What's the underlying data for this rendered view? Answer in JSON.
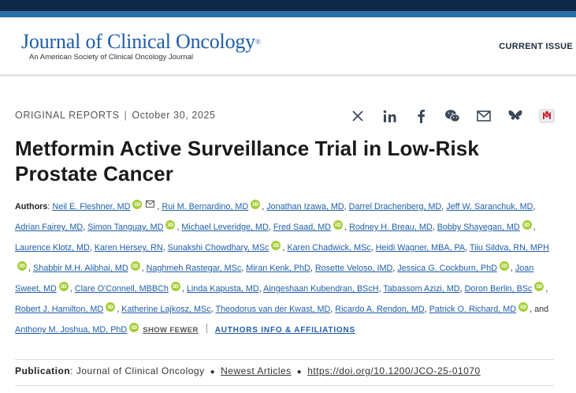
{
  "header": {
    "logo_journal": "Journal",
    "logo_rest": "of Clinical Oncology",
    "logo_reg": "®",
    "logo_subtitle": "An American Society of Clinical Oncology Journal",
    "nav_current_issue": "CURRENT ISSUE"
  },
  "article": {
    "type": "ORIGINAL REPORTS",
    "date": "October 30, 2025",
    "title": "Metformin Active Surveillance Trial in Low-Risk Prostate Cancer",
    "authors_label": "Authors",
    "authors": [
      "Neil E. Fleshner, MD",
      "Rui M. Bernardino, MD",
      "Jonathan Izawa, MD",
      "Darrel Drachenberg, MD",
      "Jeff W. Saranchuk, MD",
      "Adrian Fairey, MD",
      "Simon Tanguay, MD",
      "Michael Leveridge, MD",
      "Fred Saad, MD",
      "Rodney H. Breau, MD",
      "Bobby Shayegan, MD",
      "Laurence Klotz, MD",
      "Karen Hersey, RN",
      "Sunakshi Chowdhary, MSc",
      "Karen Chadwick, MSc",
      "Heidi Wagner, MBA, PA",
      "Tiiu Sildva, RN, MPH",
      "Shabbir M.H. Alibhai, MD",
      "Naghmeh Rastegar, MSc",
      "Miran Kenk, PhD",
      "Rosette Veloso, IMD",
      "Jessica G. Cockburn, PhD",
      "Joan Sweet, MD",
      "Clare O'Connell, MBBCh",
      "Linda Kapusta, MD",
      "Aingeshaan Kubendran, BScH",
      "Tabassom Azizi, MD",
      "Doron Berlin, BSc",
      "Robert J. Hamilton, MD",
      "Katherine Lajkosz, MSc",
      "Theodorus van der Kwast, MD",
      "Ricardo A. Rendon, MD",
      "Patrick O. Richard, MD",
      "Anthony M. Joshua, MD, PhD"
    ],
    "and_text": ", and",
    "show_fewer": "SHOW FEWER",
    "authors_info": "AUTHORS INFO & AFFILIATIONS",
    "orcid_text": "iD",
    "publication_label": "Publication",
    "publication_journal": "Journal of Clinical Oncology",
    "newest_articles": "Newest Articles",
    "doi": "https://doi.org/10.1200/JCO-25-01070"
  },
  "share_icons": [
    "x-icon",
    "linkedin-icon",
    "facebook-icon",
    "wechat-icon",
    "email-icon",
    "bluesky-icon",
    "mendeley-icon"
  ],
  "colors": {
    "top_bar": "#0e2a47",
    "top_stripe": "#2a6fa6",
    "link": "#1f5ea8",
    "orcid": "#a6ce39"
  }
}
